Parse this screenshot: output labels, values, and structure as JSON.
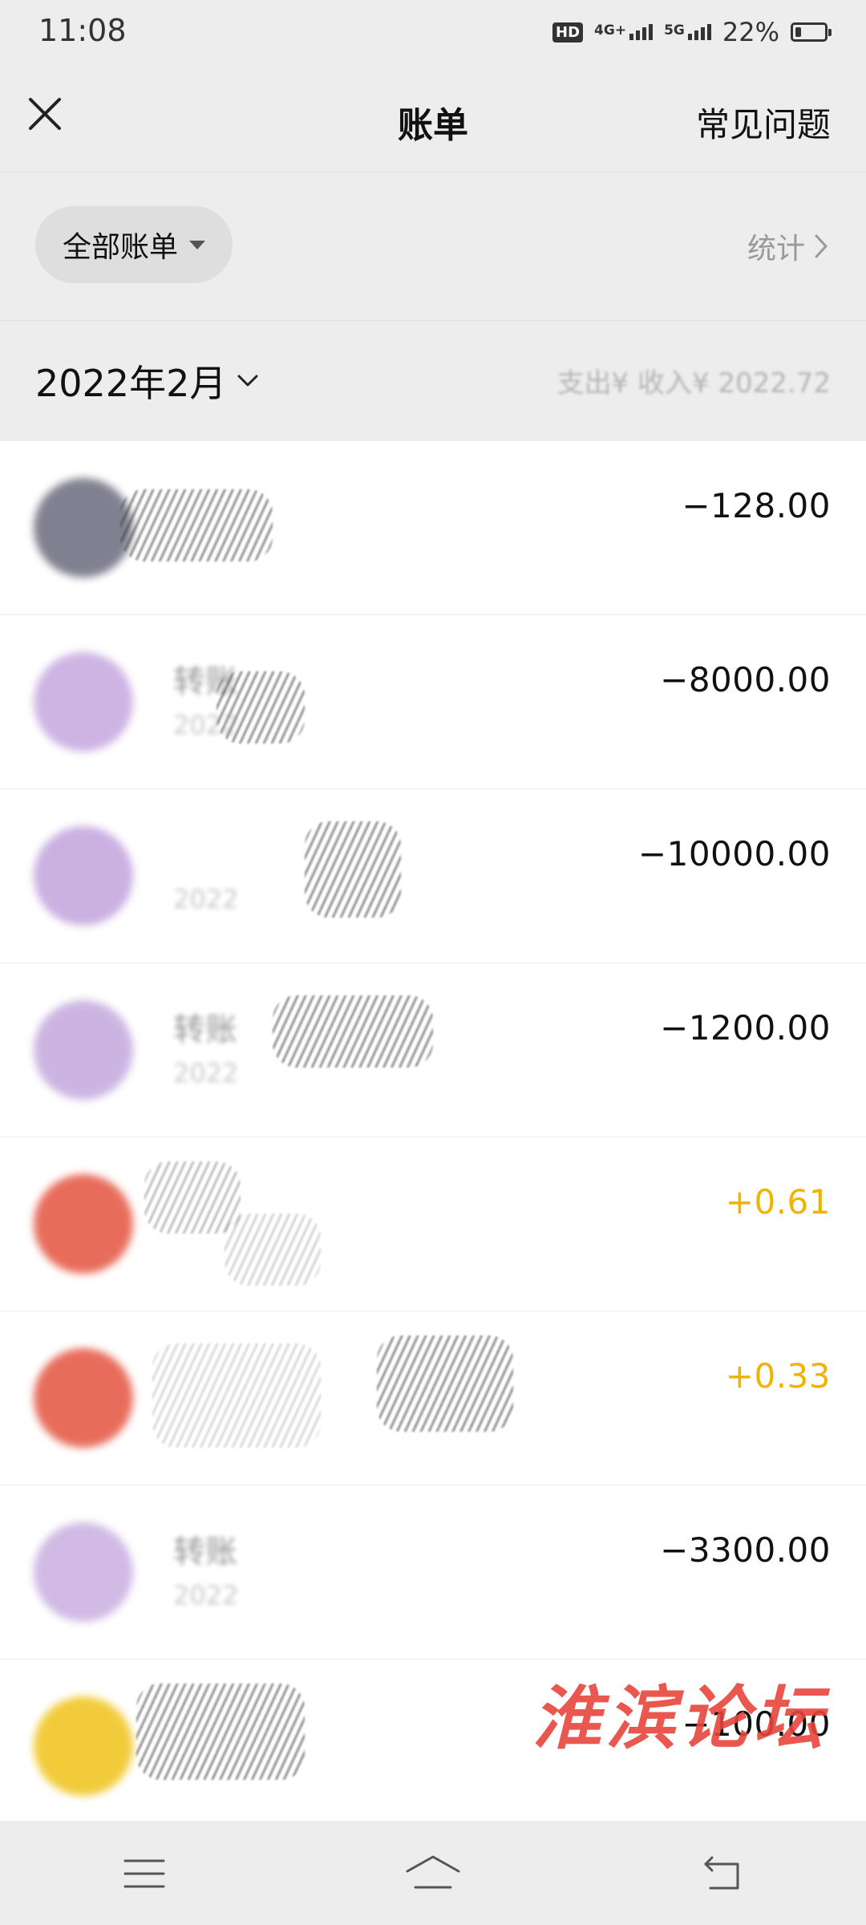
{
  "status_bar": {
    "time": "11:08",
    "hd_badge": "HD",
    "network_1": "4G+",
    "network_2": "5G",
    "battery_percent": "22%",
    "battery_level": 0.22
  },
  "header": {
    "title": "账单",
    "faq_label": "常见问题"
  },
  "filter": {
    "chip_label": "全部账单",
    "stats_label": "统计"
  },
  "month": {
    "label": "2022年2月",
    "summary": "支出¥ 收入¥ 2022.72"
  },
  "transactions": [
    {
      "title": "",
      "date": "",
      "amount": "−128.00",
      "type": "expense",
      "avatar_color": "#6b6b7e"
    },
    {
      "title": "转账",
      "date": "2022",
      "amount": "−8000.00",
      "type": "expense",
      "avatar_color": "#c6a7df"
    },
    {
      "title": "",
      "date": "2022",
      "amount": "−10000.00",
      "type": "expense",
      "avatar_color": "#c2a3dd"
    },
    {
      "title": "转账",
      "date": "2022",
      "amount": "−1200.00",
      "type": "expense",
      "avatar_color": "#c4a8de"
    },
    {
      "title": "",
      "date": "",
      "amount": "+0.61",
      "type": "income",
      "avatar_color": "#e4533f"
    },
    {
      "title": "",
      "date": "",
      "amount": "+0.33",
      "type": "income",
      "avatar_color": "#e4533f"
    },
    {
      "title": "转账",
      "date": "2022",
      "amount": "−3300.00",
      "type": "expense",
      "avatar_color": "#c9aee0"
    },
    {
      "title": "",
      "date": "",
      "amount": "−100.00",
      "type": "expense",
      "avatar_color": "#f0c31a"
    }
  ],
  "watermark": "淮滨论坛",
  "colors": {
    "background": "#ededed",
    "list_background": "#ffffff",
    "income_amount": "#f0b400",
    "expense_amount": "#111111",
    "watermark": "#e8453c"
  },
  "icons": {
    "close": "close-icon",
    "chevron_right": "chevron-right-icon",
    "chevron_down": "chevron-down-icon",
    "menu": "menu-icon",
    "home": "home-icon",
    "back": "back-icon"
  }
}
